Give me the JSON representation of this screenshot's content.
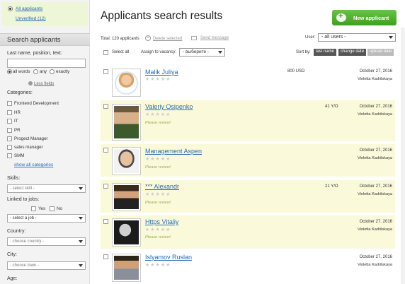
{
  "sidebar": {
    "all_applicants": "All applicants",
    "unverified": "Unverified (12)",
    "search_title": "Search applicants",
    "name_label": "Last name, position, text:",
    "match_options": [
      "all words",
      "any",
      "exactly"
    ],
    "less_fields": "Less fields",
    "categories_label": "Categories:",
    "categories": [
      "Frontend Development",
      "HR",
      "IT",
      "PR",
      "Progect Manager",
      "sales manager",
      "SMM"
    ],
    "show_all": "show all categories",
    "skills_label": "Skills:",
    "skills_placeholder": "- select skill -",
    "linked_label": "Linked to jobs:",
    "linked_yes": "Yes",
    "linked_no": "No",
    "job_placeholder": "- select a job -",
    "country_label": "Country:",
    "country_placeholder": "- choose country -",
    "city_label": "City:",
    "city_placeholder": "- choose town -",
    "age_label": "Age:"
  },
  "header": {
    "title": "Applicants search results",
    "new_button": "New applicant"
  },
  "toolbar": {
    "total": "Total: 120 applicants",
    "delete": "Delete selected",
    "send": "Send message",
    "user_label": "User:",
    "user_value": "- all users -",
    "select_all": "Select all",
    "assign_label": "Assign to vacancy:",
    "assign_value": "- выберите -",
    "sort_label": "Sort by:",
    "sort_options": [
      "last name",
      "change date",
      "upload date"
    ],
    "sort_active": "upload date"
  },
  "applicants": [
    {
      "name": "Malik Juliya",
      "salary": "800 USD",
      "age": "",
      "review": "",
      "date": "October 27, 2016",
      "owner": "Violetta Kadrilskaya"
    },
    {
      "name": "Valeriy Osipenko",
      "salary": "",
      "age": "41 Y/O",
      "review": "Please review!",
      "date": "October 27, 2016",
      "owner": "Violetta Kadrilskaya"
    },
    {
      "name": "Management Aspen",
      "salary": "",
      "age": "",
      "review": "Please review!",
      "date": "October 27, 2016",
      "owner": "Violetta Kadrilskaya"
    },
    {
      "name": "*** Alexandr",
      "salary": "",
      "age": "21 Y/O",
      "review": "Please review!",
      "date": "October 27, 2016",
      "owner": "Violetta Kadrilskaya"
    },
    {
      "name": "Https Vitaliy",
      "salary": "",
      "age": "",
      "review": "Please review!",
      "date": "October 27, 2016",
      "owner": "Violetta Kadrilskaya"
    },
    {
      "name": "Islyamov Ruslan",
      "salary": "",
      "age": "",
      "review": "",
      "date": "October 27, 2016",
      "owner": "Violetta Kadrilskaya"
    }
  ],
  "stars": "★★★★★",
  "colors": {
    "accent": "#4aa82b",
    "highlight_row": "#fafadb",
    "link": "#2a6bb3"
  }
}
